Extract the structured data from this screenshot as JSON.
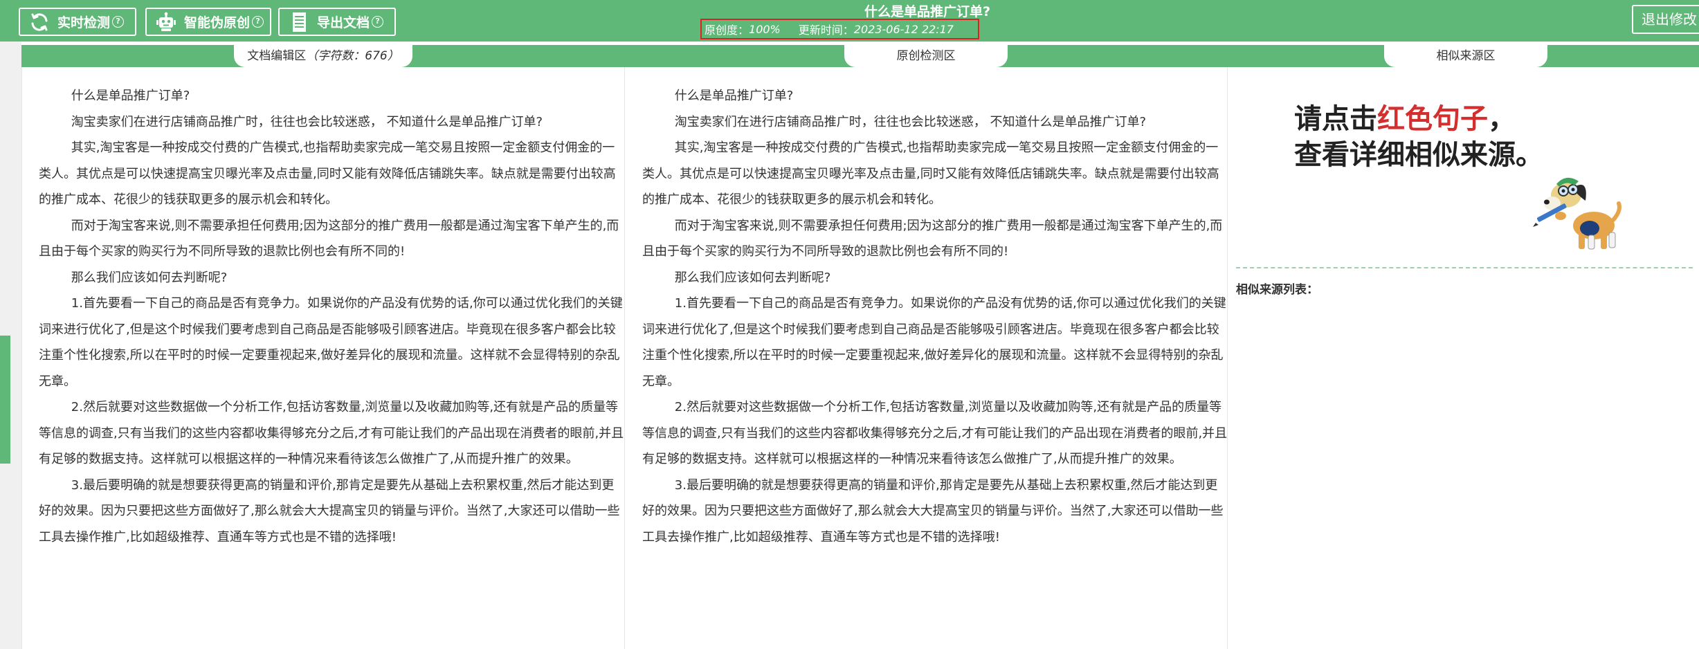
{
  "toolbar": {
    "realtime_label": "实时检测",
    "rewrite_label": "智能伪原创",
    "export_label": "导出文档",
    "help_glyph": "?",
    "exit_label": "退出修改"
  },
  "document": {
    "title": "什么是单品推广订单?",
    "originality_label": "原创度：",
    "originality_value": "100%",
    "updated_label": "更新时间：",
    "updated_value": "2023-06-12 22:17"
  },
  "tabs": {
    "editor_label": "文档编辑区",
    "char_count_text": "（字符数：676）",
    "check_label": "原创检测区",
    "source_label": "相似来源区"
  },
  "paragraphs": [
    "什么是单品推广订单?",
    "淘宝卖家们在进行店铺商品推广时，往往也会比较迷惑， 不知道什么是单品推广订单?",
    "其实,淘宝客是一种按成交付费的广告模式,也指帮助卖家完成一笔交易且按照一定金额支付佣金的一类人。其优点是可以快速提高宝贝曝光率及点击量,同时又能有效降低店铺跳失率。缺点就是需要付出较高的推广成本、花很少的钱获取更多的展示机会和转化。",
    "而对于淘宝客来说,则不需要承担任何费用;因为这部分的推广费用一般都是通过淘宝客下单产生的,而且由于每个买家的购买行为不同所导致的退款比例也会有所不同的!",
    "那么我们应该如何去判断呢?",
    "1.首先要看一下自己的商品是否有竞争力。如果说你的产品没有优势的话,你可以通过优化我们的关键词来进行优化了,但是这个时候我们要考虑到自己商品是否能够吸引顾客进店。毕竟现在很多客户都会比较注重个性化搜索,所以在平时的时候一定要重视起来,做好差异化的展现和流量。这样就不会显得特别的杂乱无章。",
    "2.然后就要对这些数据做一个分析工作,包括访客数量,浏览量以及收藏加购等,还有就是产品的质量等等信息的调查,只有当我们的这些内容都收集得够充分之后,才有可能让我们的产品出现在消费者的眼前,并且有足够的数据支持。这样就可以根据这样的一种情况来看待该怎么做推广了,从而提升推广的效果。",
    "3.最后要明确的就是想要获得更高的销量和评价,那肯定是要先从基础上去积累权重,然后才能达到更好的效果。因为只要把这些方面做好了,那么就会大大提高宝贝的销量与评价。当然了,大家还可以借助一些工具去操作推广,比如超级推荐、直通车等方式也是不错的选择哦!"
  ],
  "similar": {
    "hint_line1_pre": "请点击",
    "hint_line1_red": "红色句子",
    "hint_line1_post": "，",
    "hint_line2": "查看详细相似来源。",
    "list_label": "相似来源列表：",
    "hint_red_color": "#d32f2f"
  },
  "icons": {
    "realtime": "refresh-icon",
    "rewrite": "robot-icon",
    "export": "document-icon",
    "mascot": "dog-mascot-icon"
  },
  "colors": {
    "brand_green": "#5fb878",
    "alert_red": "#e02020"
  }
}
